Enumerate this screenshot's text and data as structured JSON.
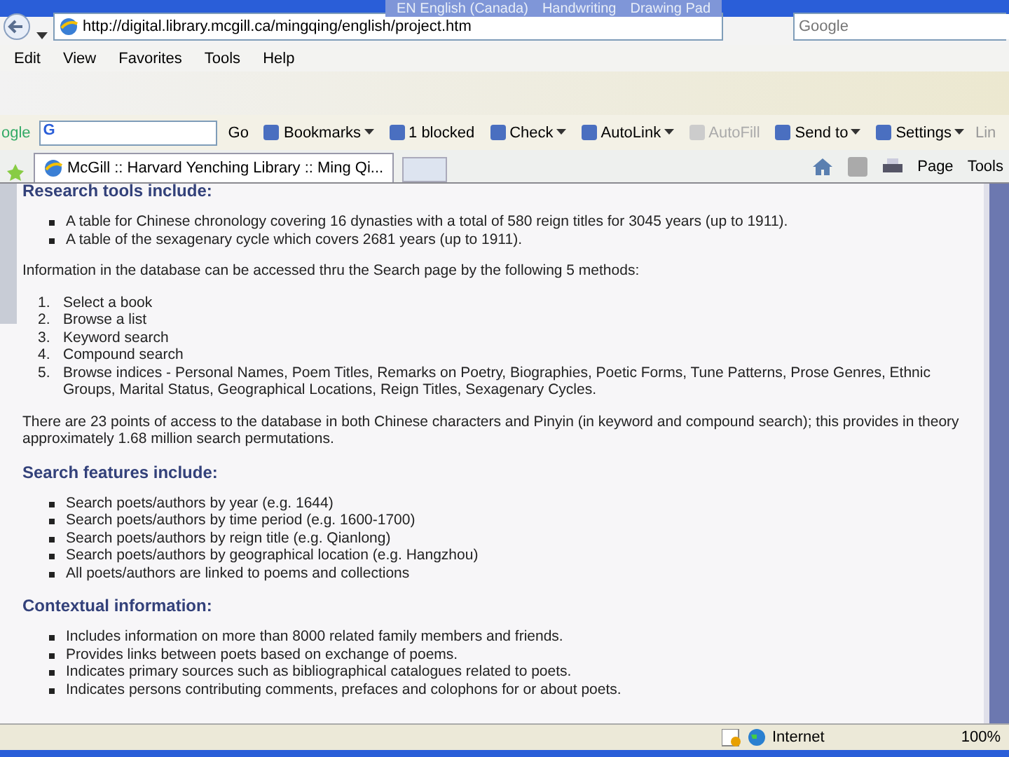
{
  "address_bar": {
    "url": "http://digital.library.mcgill.ca/mingqing/english/project.htm",
    "search_placeholder": "Google"
  },
  "language_bar": {
    "items": [
      "EN English (Canada)",
      "Handwriting",
      "Drawing Pad"
    ]
  },
  "menu": [
    "Edit",
    "View",
    "Favorites",
    "Tools",
    "Help"
  ],
  "google_toolbar": {
    "logo": "ogle",
    "field_logo": "G",
    "go": "Go",
    "items": [
      {
        "label": "Bookmarks",
        "dropdown": true,
        "disabled": false
      },
      {
        "label": "1 blocked",
        "dropdown": false,
        "disabled": false
      },
      {
        "label": "Check",
        "dropdown": true,
        "disabled": false
      },
      {
        "label": "AutoLink",
        "dropdown": true,
        "disabled": false
      },
      {
        "label": "AutoFill",
        "dropdown": false,
        "disabled": true
      },
      {
        "label": "Send to",
        "dropdown": true,
        "disabled": false
      },
      {
        "label": "Settings",
        "dropdown": true,
        "disabled": false
      }
    ],
    "overflow": "Lin"
  },
  "tabs": [
    {
      "label": "McGill :: Harvard Yenching Library :: Ming Qi...",
      "selected": true
    }
  ],
  "command_bar": [
    {
      "label": "Page"
    },
    {
      "label": "Tools"
    }
  ],
  "content": [
    {
      "kind": "heading",
      "text": "Research tools include:"
    },
    {
      "kind": "bullets",
      "items": [
        "A table for Chinese chronology covering 16 dynasties with a total of 580 reign titles for 3045 years (up to 1911).",
        "A table of the sexagenary cycle which covers 2681 years (up to 1911)."
      ]
    },
    {
      "kind": "para",
      "text": "Information in the database can be accessed thru the Search page by the following 5 methods:"
    },
    {
      "kind": "numbered",
      "items": [
        {
          "marker": "1.",
          "text": "Select a book"
        },
        {
          "marker": "2.",
          "text": "Browse a list"
        },
        {
          "marker": "3.",
          "text": "Keyword search"
        },
        {
          "marker": "4.",
          "text": "Compound search"
        },
        {
          "marker": "5.",
          "text": "Browse indices - Personal Names, Poem Titles, Remarks on Poetry, Biographies, Poetic Forms, Tune Patterns, Prose Genres, Ethnic Groups, Marital Status, Geographical Locations, Reign Titles, Sexagenary Cycles."
        }
      ]
    },
    {
      "kind": "para",
      "text": "There are 23 points of access to the database in both Chinese characters and Pinyin (in keyword and compound search); this provides in theory approximately 1.68 million search permutations."
    },
    {
      "kind": "heading",
      "text": "Search features include:"
    },
    {
      "kind": "bullets",
      "items": [
        "Search poets/authors by year (e.g. 1644)",
        "Search poets/authors by time period (e.g. 1600-1700)",
        "Search poets/authors by reign title (e.g. Qianlong)",
        "Search poets/authors by geographical location (e.g. Hangzhou)",
        "All poets/authors are linked to poems and collections"
      ]
    },
    {
      "kind": "heading",
      "text": "Contextual information:"
    },
    {
      "kind": "bullets",
      "items": [
        "Includes information on more than 8000 related family members and friends.",
        "Provides links between poets based on exchange of poems.",
        "Indicates primary sources such as bibliographical catalogues related to poets.",
        "Indicates persons contributing comments, prefaces and colophons for or about poets."
      ]
    }
  ],
  "status_bar": {
    "zone": "Internet",
    "zoom": "100%"
  }
}
